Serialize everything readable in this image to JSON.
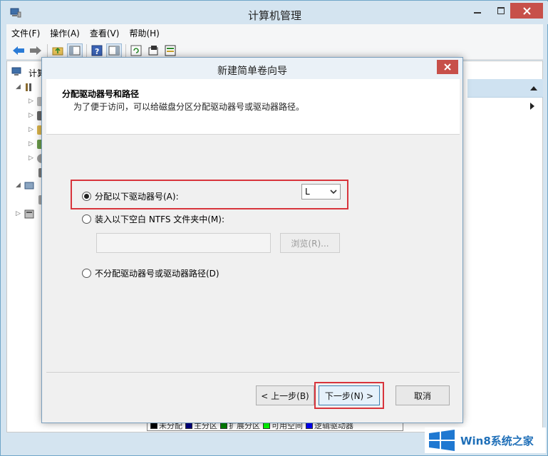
{
  "app": {
    "title": "计算机管理",
    "menu": [
      "文件(F)",
      "操作(A)",
      "查看(V)",
      "帮助(H)"
    ],
    "tree_root": "计算"
  },
  "legend": {
    "items": [
      {
        "label": "未分配",
        "color": "#000000"
      },
      {
        "label": "主分区",
        "color": "#000080"
      },
      {
        "label": "扩展分区",
        "color": "#008000"
      },
      {
        "label": "可用空间",
        "color": "#00ff00"
      },
      {
        "label": "逻辑驱动器",
        "color": "#0000ff"
      }
    ]
  },
  "dialog": {
    "title": "新建简单卷向导",
    "header_title": "分配驱动器号和路径",
    "header_subtitle": "为了便于访问，可以给磁盘分区分配驱动器号或驱动器路径。",
    "option_assign": "分配以下驱动器号(A):",
    "option_mount": "装入以下空白 NTFS 文件夹中(M):",
    "option_none": "不分配驱动器号或驱动器路径(D)",
    "drive_letter": "L",
    "browse_label": "浏览(R)...",
    "path_value": "",
    "back_label": "< 上一步(B)",
    "next_label": "下一步(N) >",
    "cancel_label": "取消"
  },
  "watermark": {
    "text": "Win8系统之家"
  }
}
